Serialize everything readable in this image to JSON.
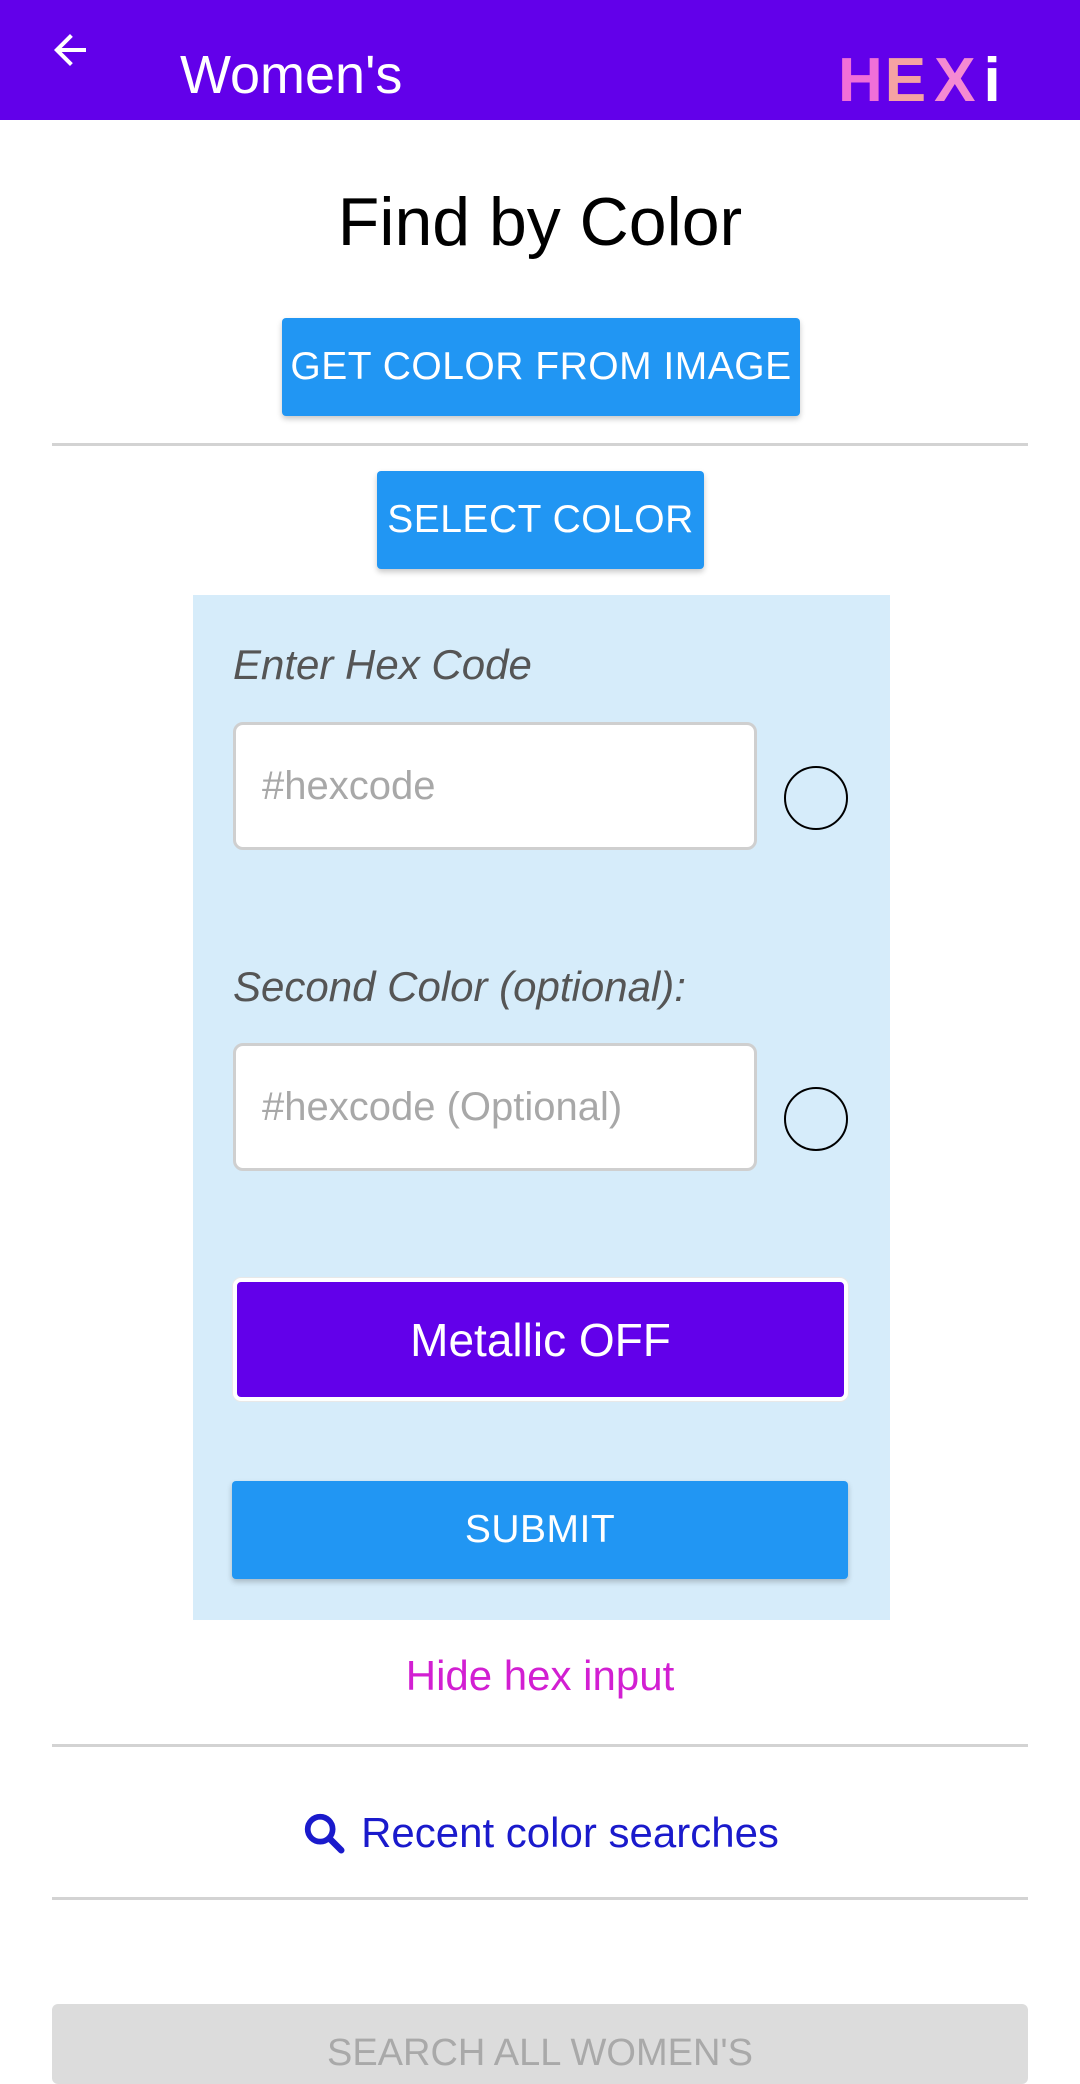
{
  "colors": {
    "appbar": "#6200EA",
    "primary_button": "#2196F3",
    "panel_bg": "#D6ECFA",
    "metallic_button": "#6200EA",
    "hide_link": "#D21FD2",
    "recent_link": "#1A1ACC",
    "logo_h": "#F06FD8",
    "logo_e": "#F5A3A3",
    "logo_x": "#F58AD2",
    "logo_i": "#FFFFFF"
  },
  "appbar": {
    "back_icon": "arrow-left-icon",
    "title": "Women's",
    "logo": [
      "H",
      "E",
      "X",
      "i"
    ]
  },
  "main": {
    "title": "Find by Color",
    "get_color_button": "GET COLOR FROM IMAGE",
    "select_color_button": "SELECT COLOR"
  },
  "hex_panel": {
    "hex_label": "Enter Hex Code",
    "hex_placeholder": "#hexcode",
    "hex_value": "",
    "second_label": "Second Color (optional):",
    "second_placeholder": "#hexcode (Optional)",
    "second_value": "",
    "metallic_button": "Metallic OFF",
    "submit_button": "SUBMIT"
  },
  "links": {
    "hide_hex": "Hide hex input",
    "recent_searches": "Recent color searches",
    "recent_icon": "search-icon"
  },
  "footer": {
    "search_all_button": "SEARCH ALL WOMEN'S"
  }
}
